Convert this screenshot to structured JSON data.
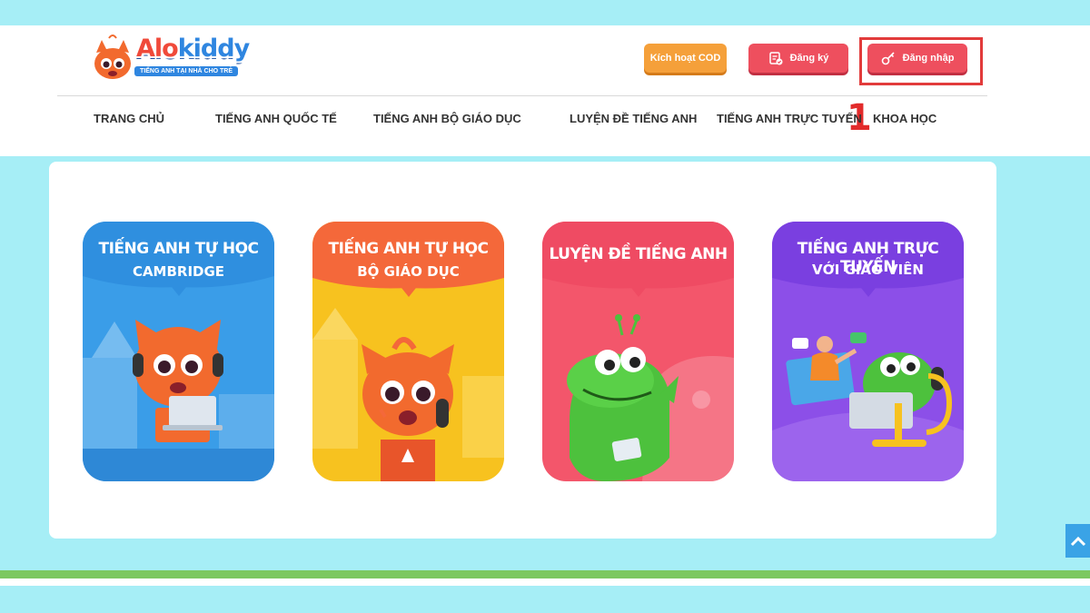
{
  "logo": {
    "brand_part1": "Alo",
    "brand_part2": "kiddy",
    "tagline": "TIẾNG ANH TẠI NHÀ CHO TRẺ"
  },
  "header_buttons": {
    "cod": "Kích hoạt COD",
    "register": "Đăng ký",
    "login": "Đăng nhập"
  },
  "step_marker": "1",
  "nav": [
    "TRANG CHỦ",
    "TIẾNG ANH QUỐC TẾ",
    "TIẾNG ANH BỘ GIÁO DỤC",
    "LUYỆN ĐỀ TIẾNG ANH",
    "TIẾNG ANH TRỰC TUYẾN",
    "KHOA HỌC"
  ],
  "cards": [
    {
      "title": "TIẾNG ANH TỰ HỌC",
      "subtitle": "CAMBRIDGE",
      "color": "#3a9de8"
    },
    {
      "title": "TIẾNG ANH TỰ HỌC",
      "subtitle": "BỘ GIÁO DỤC",
      "color": "#f7c21f"
    },
    {
      "title": "LUYỆN ĐỀ TIẾNG ANH",
      "subtitle": "",
      "color": "#f3566b"
    },
    {
      "title": "TIẾNG ANH TRỰC TUYẾN",
      "subtitle": "VỚI GIÁO VIÊN",
      "color": "#8c4fe8"
    }
  ],
  "icons": {
    "register": "clipboard-check-icon",
    "login": "key-icon",
    "scroll_top": "chevron-up-icon"
  }
}
